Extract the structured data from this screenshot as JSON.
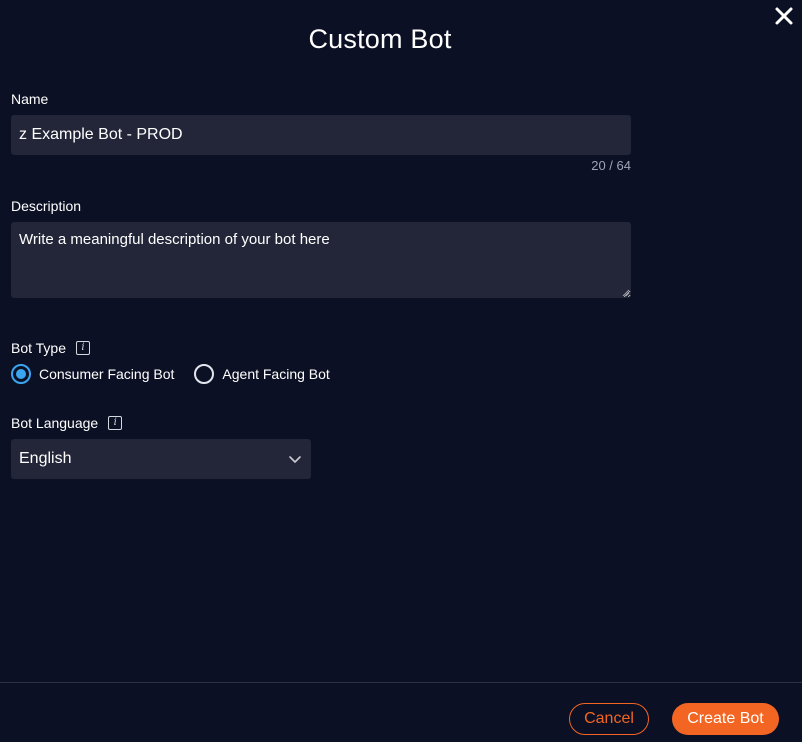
{
  "dialog": {
    "title": "Custom Bot",
    "close_icon": "close-icon"
  },
  "name_field": {
    "label": "Name",
    "value": "z Example Bot - PROD",
    "char_count": "20 / 64"
  },
  "description_field": {
    "label": "Description",
    "placeholder": "Write a meaningful description of your bot here"
  },
  "bot_type": {
    "label": "Bot Type",
    "info_icon": "info-icon",
    "options": [
      {
        "label": "Consumer Facing Bot",
        "selected": true
      },
      {
        "label": "Agent Facing Bot",
        "selected": false
      }
    ]
  },
  "bot_language": {
    "label": "Bot Language",
    "info_icon": "info-icon",
    "selected": "English"
  },
  "footer": {
    "cancel_label": "Cancel",
    "create_label": "Create Bot"
  },
  "colors": {
    "background": "#0c1024",
    "input_bg": "#232638",
    "accent": "#f26522",
    "radio_selected": "#3aa6f0"
  }
}
